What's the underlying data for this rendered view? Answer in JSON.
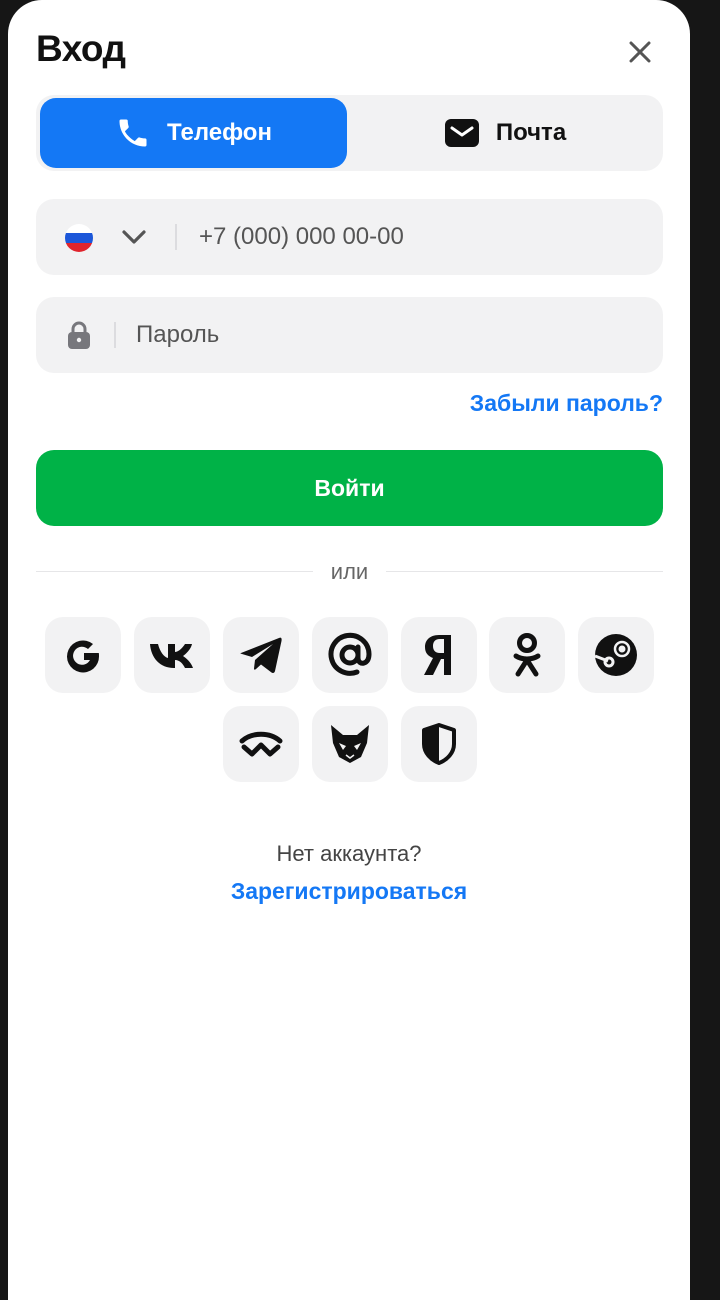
{
  "header": {
    "title": "Вход",
    "close_icon": "close-icon"
  },
  "tabs": [
    {
      "label": "Телефон",
      "icon": "phone-icon",
      "active": true
    },
    {
      "label": "Почта",
      "icon": "mail-icon",
      "active": false
    }
  ],
  "phone_field": {
    "country_icon": "russia-flag-icon",
    "placeholder": "+7 (000) 000 00-00",
    "value": ""
  },
  "password_field": {
    "icon": "lock-icon",
    "placeholder": "Пароль",
    "value": ""
  },
  "forgot_password": "Забыли пароль?",
  "login_button": "Войти",
  "separator": "или",
  "social_icons": [
    "google-icon",
    "vk-icon",
    "telegram-icon",
    "mailru-icon",
    "yandex-icon",
    "odnoklassniki-icon",
    "steam-icon",
    "walletconnect-icon",
    "metamask-icon",
    "shield-icon"
  ],
  "footer": {
    "question": "Нет аккаунта?",
    "register_link": "Зарегистрироваться"
  },
  "colors": {
    "accent_blue": "#1478f5",
    "login_green": "#00b247",
    "field_bg": "#f2f2f3",
    "flag_white": "#ffffff",
    "flag_blue": "#1c57d9",
    "flag_red": "#e0242c"
  }
}
